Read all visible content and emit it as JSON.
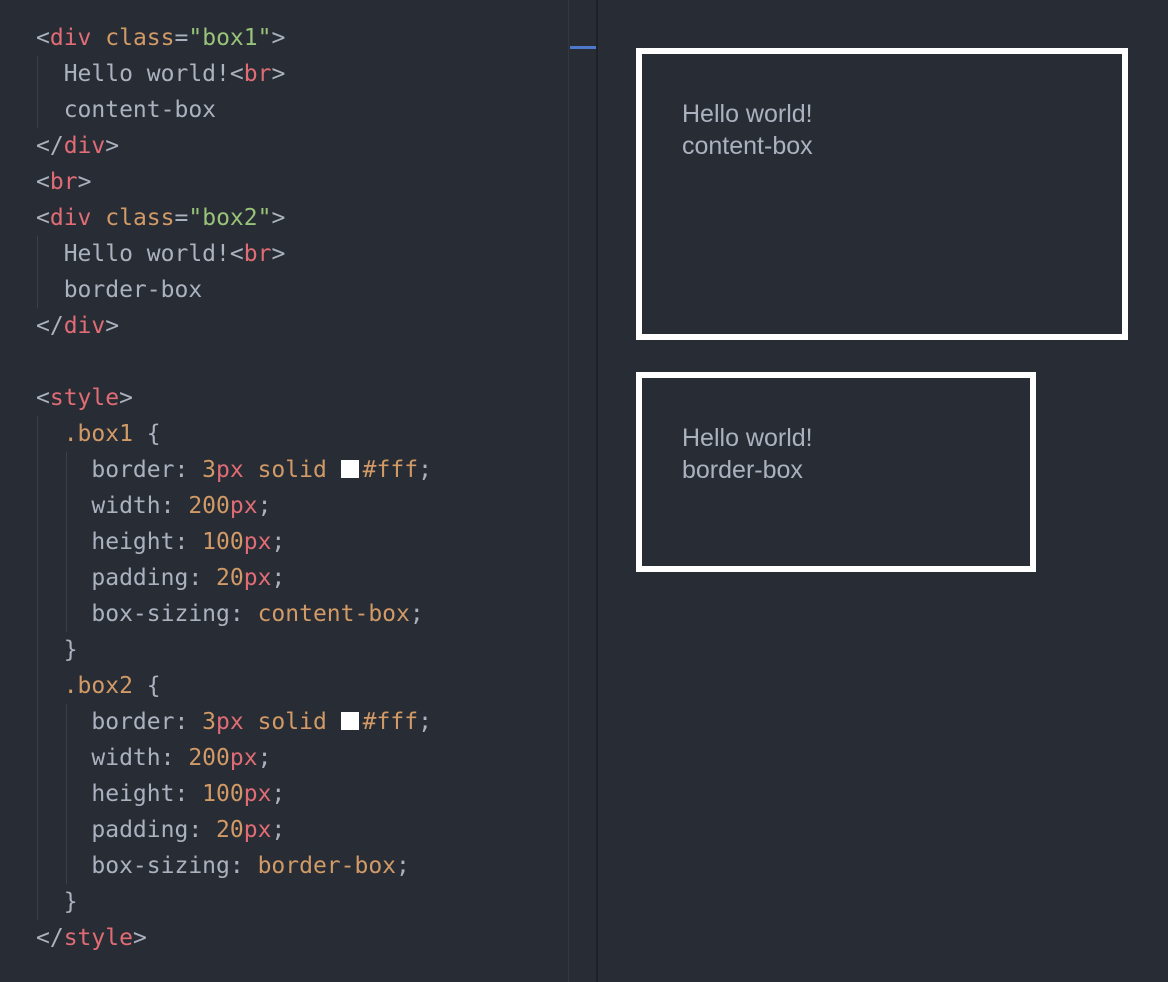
{
  "code": {
    "lines": [
      [
        {
          "t": "<",
          "c": "punct"
        },
        {
          "t": "div",
          "c": "tag"
        },
        {
          "t": " ",
          "c": "text"
        },
        {
          "t": "class",
          "c": "attr"
        },
        {
          "t": "=",
          "c": "punct"
        },
        {
          "t": "\"box1\"",
          "c": "str"
        },
        {
          "t": ">",
          "c": "punct"
        }
      ],
      [
        {
          "t": "  Hello world!",
          "c": "text"
        },
        {
          "t": "<",
          "c": "punct"
        },
        {
          "t": "br",
          "c": "tag"
        },
        {
          "t": ">",
          "c": "punct"
        }
      ],
      [
        {
          "t": "  content-box",
          "c": "text"
        }
      ],
      [
        {
          "t": "</",
          "c": "punct"
        },
        {
          "t": "div",
          "c": "tag"
        },
        {
          "t": ">",
          "c": "punct"
        }
      ],
      [
        {
          "t": "<",
          "c": "punct"
        },
        {
          "t": "br",
          "c": "tag"
        },
        {
          "t": ">",
          "c": "punct"
        }
      ],
      [
        {
          "t": "<",
          "c": "punct"
        },
        {
          "t": "div",
          "c": "tag"
        },
        {
          "t": " ",
          "c": "text"
        },
        {
          "t": "class",
          "c": "attr"
        },
        {
          "t": "=",
          "c": "punct"
        },
        {
          "t": "\"box2\"",
          "c": "str"
        },
        {
          "t": ">",
          "c": "punct"
        }
      ],
      [
        {
          "t": "  Hello world!",
          "c": "text"
        },
        {
          "t": "<",
          "c": "punct"
        },
        {
          "t": "br",
          "c": "tag"
        },
        {
          "t": ">",
          "c": "punct"
        }
      ],
      [
        {
          "t": "  border-box",
          "c": "text"
        }
      ],
      [
        {
          "t": "</",
          "c": "punct"
        },
        {
          "t": "div",
          "c": "tag"
        },
        {
          "t": ">",
          "c": "punct"
        }
      ],
      [],
      [
        {
          "t": "<",
          "c": "punct"
        },
        {
          "t": "style",
          "c": "tag"
        },
        {
          "t": ">",
          "c": "punct"
        }
      ],
      [
        {
          "t": "  .box1",
          "c": "sel"
        },
        {
          "t": " {",
          "c": "punct"
        }
      ],
      [
        {
          "t": "    border: ",
          "c": "prop"
        },
        {
          "t": "3",
          "c": "num"
        },
        {
          "t": "px",
          "c": "unit"
        },
        {
          "t": " solid ",
          "c": "kw"
        },
        {
          "swatch": "#ffffff"
        },
        {
          "t": "#fff",
          "c": "kw"
        },
        {
          "t": ";",
          "c": "punct"
        }
      ],
      [
        {
          "t": "    width: ",
          "c": "prop"
        },
        {
          "t": "200",
          "c": "num"
        },
        {
          "t": "px",
          "c": "unit"
        },
        {
          "t": ";",
          "c": "punct"
        }
      ],
      [
        {
          "t": "    height: ",
          "c": "prop"
        },
        {
          "t": "100",
          "c": "num"
        },
        {
          "t": "px",
          "c": "unit"
        },
        {
          "t": ";",
          "c": "punct"
        }
      ],
      [
        {
          "t": "    padding: ",
          "c": "prop"
        },
        {
          "t": "20",
          "c": "num"
        },
        {
          "t": "px",
          "c": "unit"
        },
        {
          "t": ";",
          "c": "punct"
        }
      ],
      [
        {
          "t": "    box-sizing: ",
          "c": "prop"
        },
        {
          "t": "content-box",
          "c": "kw"
        },
        {
          "t": ";",
          "c": "punct"
        }
      ],
      [
        {
          "t": "  }",
          "c": "punct"
        }
      ],
      [
        {
          "t": "  .box2",
          "c": "sel"
        },
        {
          "t": " {",
          "c": "punct"
        }
      ],
      [
        {
          "t": "    border: ",
          "c": "prop"
        },
        {
          "t": "3",
          "c": "num"
        },
        {
          "t": "px",
          "c": "unit"
        },
        {
          "t": " solid ",
          "c": "kw"
        },
        {
          "swatch": "#ffffff"
        },
        {
          "t": "#fff",
          "c": "kw"
        },
        {
          "t": ";",
          "c": "punct"
        }
      ],
      [
        {
          "t": "    width: ",
          "c": "prop"
        },
        {
          "t": "200",
          "c": "num"
        },
        {
          "t": "px",
          "c": "unit"
        },
        {
          "t": ";",
          "c": "punct"
        }
      ],
      [
        {
          "t": "    height: ",
          "c": "prop"
        },
        {
          "t": "100",
          "c": "num"
        },
        {
          "t": "px",
          "c": "unit"
        },
        {
          "t": ";",
          "c": "punct"
        }
      ],
      [
        {
          "t": "    padding: ",
          "c": "prop"
        },
        {
          "t": "20",
          "c": "num"
        },
        {
          "t": "px",
          "c": "unit"
        },
        {
          "t": ";",
          "c": "punct"
        }
      ],
      [
        {
          "t": "    box-sizing: ",
          "c": "prop"
        },
        {
          "t": "border-box",
          "c": "kw"
        },
        {
          "t": ";",
          "c": "punct"
        }
      ],
      [
        {
          "t": "  }",
          "c": "punct"
        }
      ],
      [
        {
          "t": "</",
          "c": "punct"
        },
        {
          "t": "style",
          "c": "tag"
        },
        {
          "t": ">",
          "c": "punct"
        }
      ]
    ]
  },
  "preview": {
    "box1": {
      "line1": "Hello world!",
      "line2": "content-box"
    },
    "box2": {
      "line1": "Hello world!",
      "line2": "border-box"
    }
  },
  "colors": {
    "background": "#282c34",
    "tag": "#e06c75",
    "attribute": "#d19a66",
    "string": "#98c379",
    "text": "#abb2bf",
    "box_border": "#ffffff",
    "scroll_marker": "#4d78cc"
  }
}
